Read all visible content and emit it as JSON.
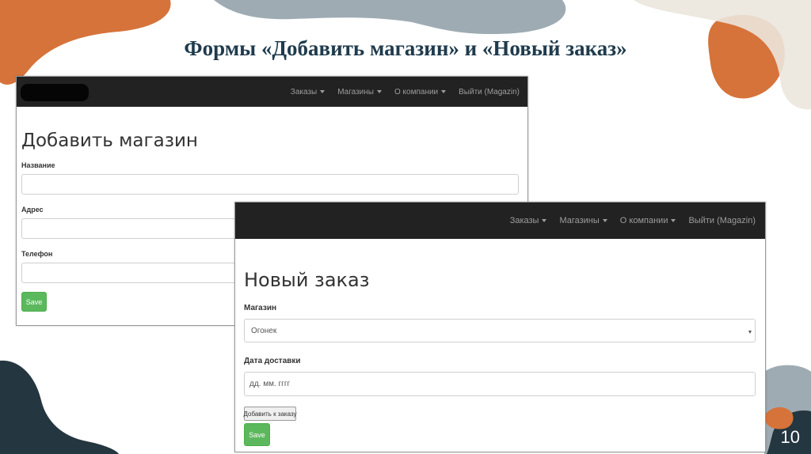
{
  "slide": {
    "title": "Формы «Добавить магазин» и «Новый заказ»",
    "page_number": "10",
    "colors": {
      "orange": "#d6733a",
      "slate": "#9eabb3",
      "dark": "#243640",
      "beige": "#ebe6dd"
    }
  },
  "add_store": {
    "nav": {
      "items": [
        "Заказы",
        "Магазины",
        "О компании",
        "Выйти (Magazin)"
      ]
    },
    "heading": "Добавить магазин",
    "fields": [
      {
        "label": "Название",
        "value": ""
      },
      {
        "label": "Адрес",
        "value": ""
      },
      {
        "label": "Телефон",
        "value": ""
      }
    ],
    "save_label": "Save"
  },
  "new_order": {
    "nav": {
      "items": [
        "Заказы",
        "Магазины",
        "О компании",
        "Выйти (Magazin)"
      ]
    },
    "heading": "Новый заказ",
    "store_label": "Магазин",
    "store_selected": "Огонек",
    "date_label": "Дата доставки",
    "date_placeholder": "дд. мм. гггг",
    "add_to_order_label": "Добавить к заказу",
    "save_label": "Save"
  }
}
